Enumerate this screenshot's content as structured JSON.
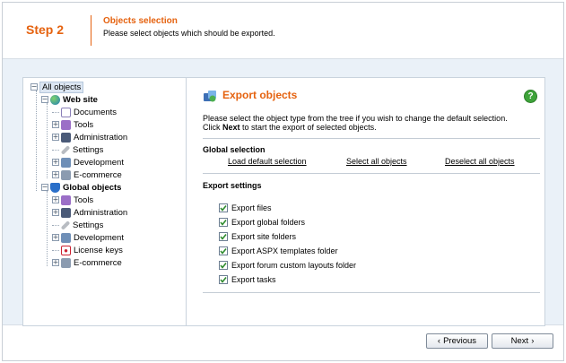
{
  "header": {
    "step": "Step 2",
    "title": "Objects selection",
    "subtitle": "Please select objects which should be exported."
  },
  "tree": {
    "items": [
      {
        "label": "All objects"
      },
      {
        "label": "Web site"
      },
      {
        "label": "Documents"
      },
      {
        "label": "Tools"
      },
      {
        "label": "Administration"
      },
      {
        "label": "Settings"
      },
      {
        "label": "Development"
      },
      {
        "label": "E-commerce"
      },
      {
        "label": "Global objects"
      },
      {
        "label": "Tools"
      },
      {
        "label": "Administration"
      },
      {
        "label": "Settings"
      },
      {
        "label": "Development"
      },
      {
        "label": "License keys"
      },
      {
        "label": "E-commerce"
      }
    ]
  },
  "content": {
    "title": "Export objects",
    "help": "?",
    "intro_line1": "Please select the object type from the tree if you wish to change the default selection.",
    "intro_click": "Click ",
    "intro_next": "Next",
    "intro_rest": " to start the export of selected objects.",
    "global_selection_heading": "Global selection",
    "links": {
      "load_default": "Load default selection",
      "select_all": "Select all objects",
      "deselect_all": "Deselect all objects"
    },
    "export_settings_heading": "Export settings",
    "settings": [
      {
        "label": "Export files",
        "checked": true
      },
      {
        "label": "Export global folders",
        "checked": true
      },
      {
        "label": "Export site folders",
        "checked": true
      },
      {
        "label": "Export ASPX templates folder",
        "checked": true
      },
      {
        "label": "Export forum custom layouts folder",
        "checked": true
      },
      {
        "label": "Export tasks",
        "checked": true
      }
    ]
  },
  "footer": {
    "previous_label": "Previous",
    "next_label": "Next"
  },
  "colors": {
    "accent": "#e5620f",
    "panel_bg": "#eaf1f8",
    "help_green": "#3ea33a"
  }
}
